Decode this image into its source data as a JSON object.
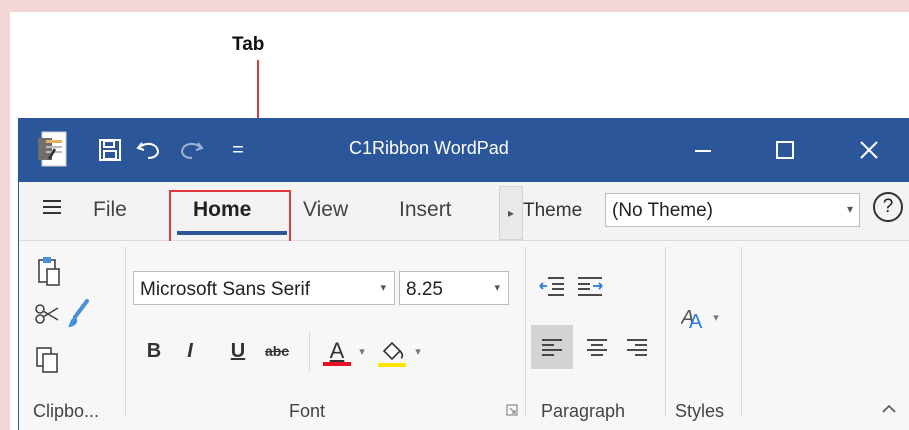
{
  "annotation": {
    "label": "Tab",
    "color": "#e0393e"
  },
  "window": {
    "title": "C1Ribbon WordPad",
    "accent": "#2b579a",
    "controls": {
      "minimize": "—",
      "maximize": "☐",
      "close": "✕"
    }
  },
  "quick_access": {
    "more": "="
  },
  "tabs": {
    "menu_icon": "hamburger-icon",
    "items": [
      {
        "label": "File"
      },
      {
        "label": "Home"
      },
      {
        "label": "View"
      },
      {
        "label": "Insert"
      }
    ],
    "active": "Home"
  },
  "theme": {
    "label": "Theme",
    "value": "(No Theme)"
  },
  "help": {
    "label": "?"
  },
  "ribbon": {
    "font_name": "Microsoft Sans Serif",
    "font_size": "8.25",
    "format_buttons": {
      "bold": "B",
      "italic": "I",
      "underline": "U",
      "strike": "abc",
      "font_color": "A"
    },
    "groups": {
      "clipboard": "Clipbo...",
      "font": "Font",
      "paragraph": "Paragraph",
      "styles": "Styles"
    },
    "font_color": "#e81123",
    "highlight_color": "#ffe600"
  }
}
